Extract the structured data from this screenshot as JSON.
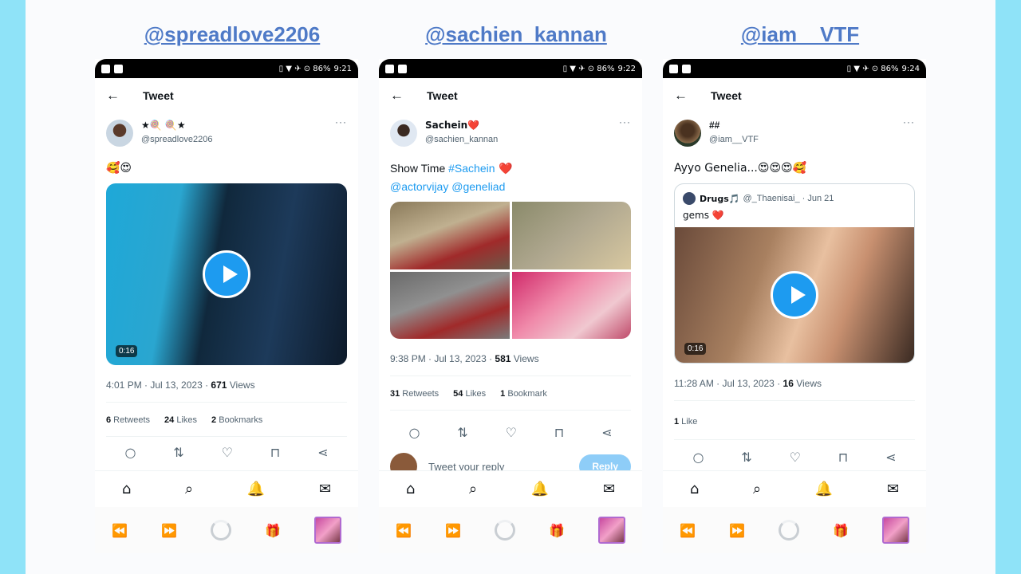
{
  "columns": [
    {
      "label": "@spreadlove2206"
    },
    {
      "label": "@sachien_kannan"
    },
    {
      "label": "@iam__VTF"
    }
  ],
  "statusbar": {
    "icons": "▯ ▼ ✈ ⊙ 86%",
    "time1": "9:21",
    "time2": "9:22",
    "time3": "9:24"
  },
  "common": {
    "back": "←",
    "title": "Tweet",
    "more": "···"
  },
  "p1": {
    "display_name": "★🍭              🍭★",
    "handle": "@spreadlove2206",
    "text": "🥰😍",
    "duration": "0:16",
    "time": "4:01 PM · Jul 13, 2023 · ",
    "views_count": "671",
    "views_label": " Views",
    "retweets_count": "6",
    "retweets_label": " Retweets",
    "likes_count": "24",
    "likes_label": " Likes",
    "bookmarks_count": "2",
    "bookmarks_label": " Bookmarks"
  },
  "p2": {
    "display_name": "Sachein❤️",
    "handle": "@sachien_kannan",
    "text": "Show Time ",
    "hashtag": "#Sachein",
    "heart": " ❤️",
    "mentions": "@actorvijay @geneliad",
    "time": "9:38 PM · Jul 13, 2023 · ",
    "views_count": "581",
    "views_label": " Views",
    "retweets_count": "31",
    "retweets_label": " Retweets",
    "likes_count": "54",
    "likes_label": " Likes",
    "bookmarks_count": "1",
    "bookmarks_label": " Bookmark",
    "reply_placeholder": "Tweet your reply",
    "reply_button": "Reply"
  },
  "p3": {
    "display_name": "##",
    "handle": "@iam__VTF",
    "text": "Ayyo Genelia...😍😍😍🥰",
    "quote_name": "Drugs🎵",
    "quote_rest": "@_Thaenisai_ · Jun 21",
    "quote_text": "gems ❤️",
    "duration": "0:16",
    "time": "11:28 AM · Jul 13, 2023 · ",
    "views_count": "16",
    "views_label": " Views",
    "likes_count": "1",
    "likes_label": " Like"
  },
  "icons": {
    "reply": "○",
    "retweet": "⇅",
    "like": "♡",
    "bookmark": "⊓",
    "share": "⋖",
    "home": "⌂",
    "search": "⌕",
    "bell": "🔔",
    "mail": "✉",
    "rewind": "⏪",
    "forward": "⏩",
    "gift": "🎁"
  }
}
